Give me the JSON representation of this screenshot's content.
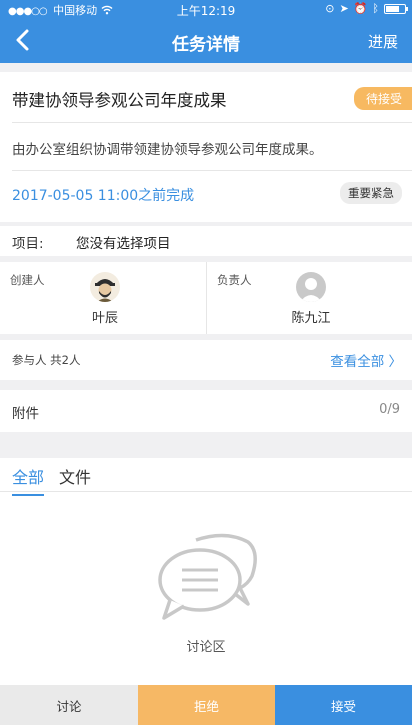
{
  "status_bar": {
    "carrier": "中国移动",
    "time": "上午12:19",
    "battery_level": 0.7
  },
  "nav": {
    "title": "任务详情",
    "action": "进展",
    "back_icon": "chevron-left-icon"
  },
  "task": {
    "title": "带建协领导参观公司年度成果",
    "status": "待接受",
    "description": "由办公室组织协调带领建协领导参观公司年度成果。",
    "due": "2017-05-05 11:00之前完成",
    "priority": "重要紧急"
  },
  "project": {
    "label": "项目:",
    "value": "您没有选择项目"
  },
  "people": {
    "creator_role": "创建人",
    "creator_name": "叶辰",
    "assignee_role": "负责人",
    "assignee_name": "陈九江"
  },
  "participants": {
    "label": "参与人 共2人",
    "view_all": "查看全部 〉"
  },
  "attachments": {
    "label": "附件",
    "count": "0/9"
  },
  "tabs": [
    {
      "label": "全部",
      "active": true
    },
    {
      "label": "文件",
      "active": false
    }
  ],
  "discussion": {
    "empty_label": "讨论区"
  },
  "actions": {
    "discuss": "讨论",
    "reject": "拒绝",
    "accept": "接受"
  },
  "colors": {
    "primary": "#3a8fe0",
    "warning": "#f6b865",
    "background": "#f0f0f2"
  }
}
